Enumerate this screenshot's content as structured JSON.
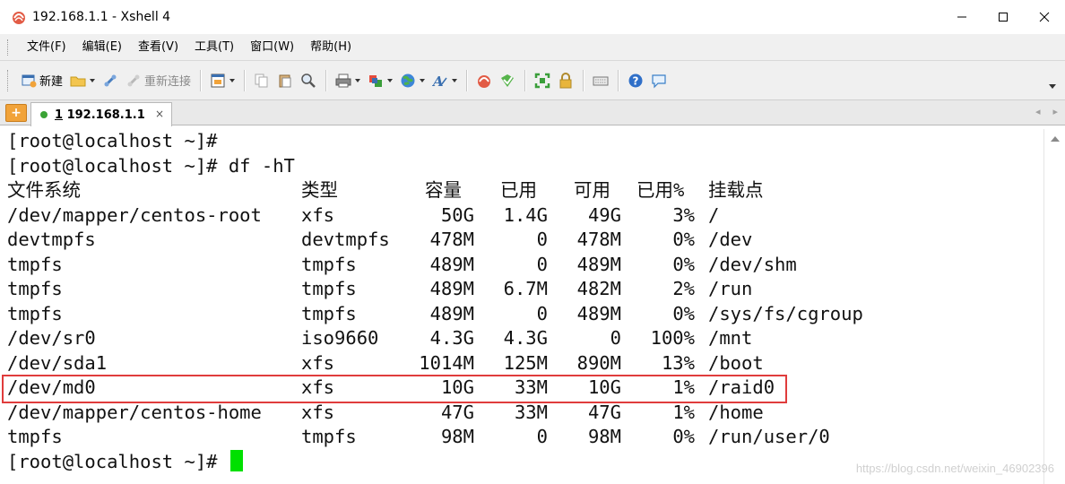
{
  "window": {
    "title": "192.168.1.1 - Xshell 4"
  },
  "menu": [
    "文件(F)",
    "编辑(E)",
    "查看(V)",
    "工具(T)",
    "窗口(W)",
    "帮助(H)"
  ],
  "toolbar": {
    "new_label": "新建",
    "reconnect_label": "重新连接"
  },
  "tab": {
    "number": "1",
    "host": "192.168.1.1",
    "close": "×",
    "nav_prev": "◂",
    "nav_next": "▸"
  },
  "terminal": {
    "prompt1": "[root@localhost ~]#",
    "prompt2": "[root@localhost ~]# df -hT",
    "prompt_last": "[root@localhost ~]#",
    "headers": [
      "文件系统",
      "类型",
      "容量",
      "已用",
      "可用",
      "已用%",
      "挂载点"
    ],
    "rows": [
      [
        "/dev/mapper/centos-root",
        "xfs",
        "50G",
        "1.4G",
        "49G",
        "3%",
        "/"
      ],
      [
        "devtmpfs",
        "devtmpfs",
        "478M",
        "0",
        "478M",
        "0%",
        "/dev"
      ],
      [
        "tmpfs",
        "tmpfs",
        "489M",
        "0",
        "489M",
        "0%",
        "/dev/shm"
      ],
      [
        "tmpfs",
        "tmpfs",
        "489M",
        "6.7M",
        "482M",
        "2%",
        "/run"
      ],
      [
        "tmpfs",
        "tmpfs",
        "489M",
        "0",
        "489M",
        "0%",
        "/sys/fs/cgroup"
      ],
      [
        "/dev/sr0",
        "iso9660",
        "4.3G",
        "4.3G",
        "0",
        "100%",
        "/mnt"
      ],
      [
        "/dev/sda1",
        "xfs",
        "1014M",
        "125M",
        "890M",
        "13%",
        "/boot"
      ],
      [
        "/dev/md0",
        "xfs",
        "10G",
        "33M",
        "10G",
        "1%",
        "/raid0"
      ],
      [
        "/dev/mapper/centos-home",
        "xfs",
        "47G",
        "33M",
        "47G",
        "1%",
        "/home"
      ],
      [
        "tmpfs",
        "tmpfs",
        "98M",
        "0",
        "98M",
        "0%",
        "/run/user/0"
      ]
    ],
    "highlight_color": "#e03c3c",
    "cursor_color": "#00e000"
  },
  "watermark": "https://blog.csdn.net/weixin_46902396"
}
